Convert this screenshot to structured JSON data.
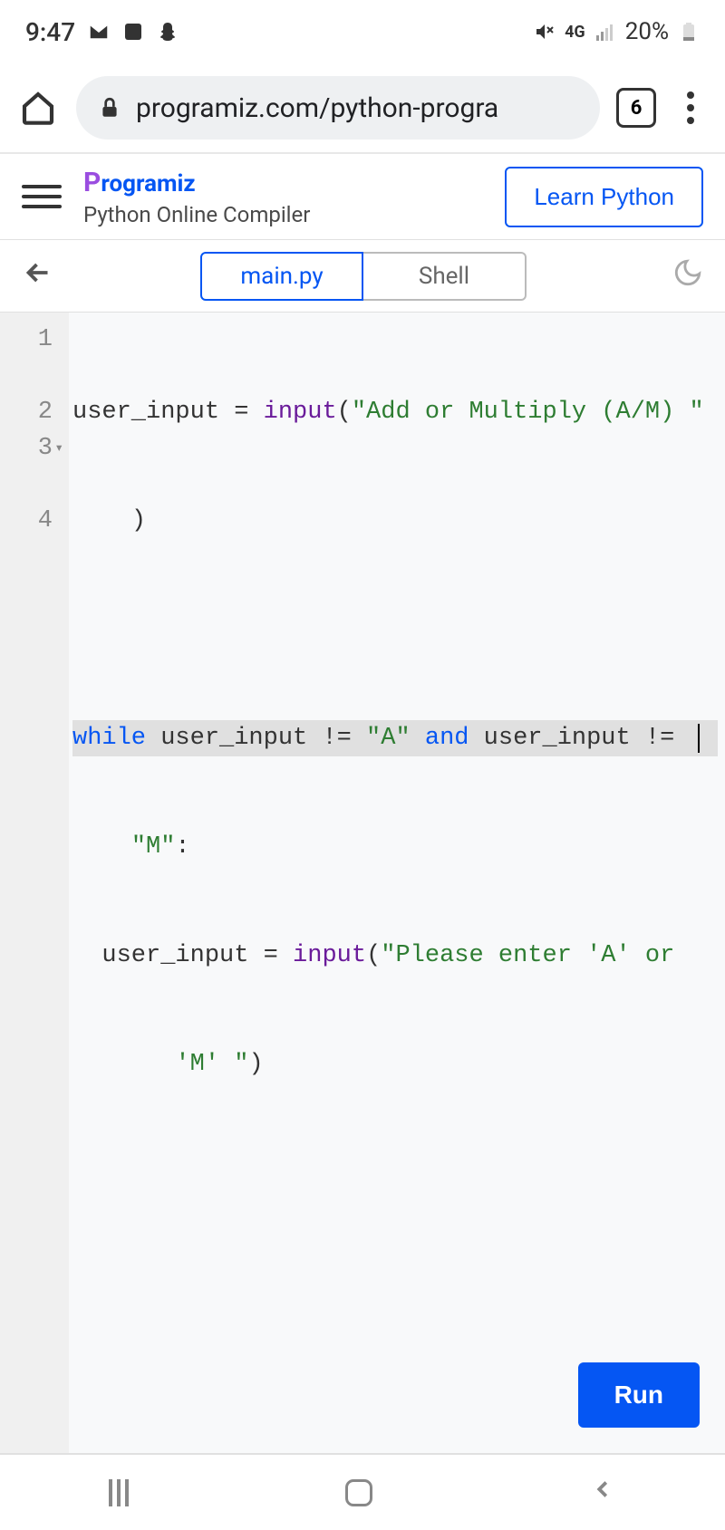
{
  "status": {
    "time": "9:47",
    "battery": "20%",
    "network": "4G"
  },
  "browser": {
    "url": "programiz.com/python-progra",
    "tab_count": "6"
  },
  "site": {
    "brand": "rogramiz",
    "subtitle": "Python Online Compiler",
    "learn_label": "Learn Python"
  },
  "tabs": {
    "main": "main.py",
    "shell": "Shell"
  },
  "code": {
    "line_numbers": [
      "1",
      "",
      "2",
      "3",
      "",
      "4",
      ""
    ],
    "line1_var": "user_input ",
    "line1_op": "= ",
    "line1_fn": "input",
    "line1_paren": "(",
    "line1_str": "\"Add or Multiply (A/M) \"",
    "line1b_paren": ")",
    "line3_kw": "while",
    "line3_txt1": " user_input ",
    "line3_op1": "!=",
    "line3_str1": " \"A\" ",
    "line3_kw2": "and",
    "line3_txt2": " user_input ",
    "line3_op2": "!=",
    "line3b_str": "\"M\"",
    "line3b_colon": ":",
    "line4_var": "user_input ",
    "line4_op": "= ",
    "line4_fn": "input",
    "line4_paren": "(",
    "line4_str": "\"Please enter 'A' or",
    "line4b_str": "'M' \"",
    "line4b_paren": ")"
  },
  "run_label": "Run"
}
